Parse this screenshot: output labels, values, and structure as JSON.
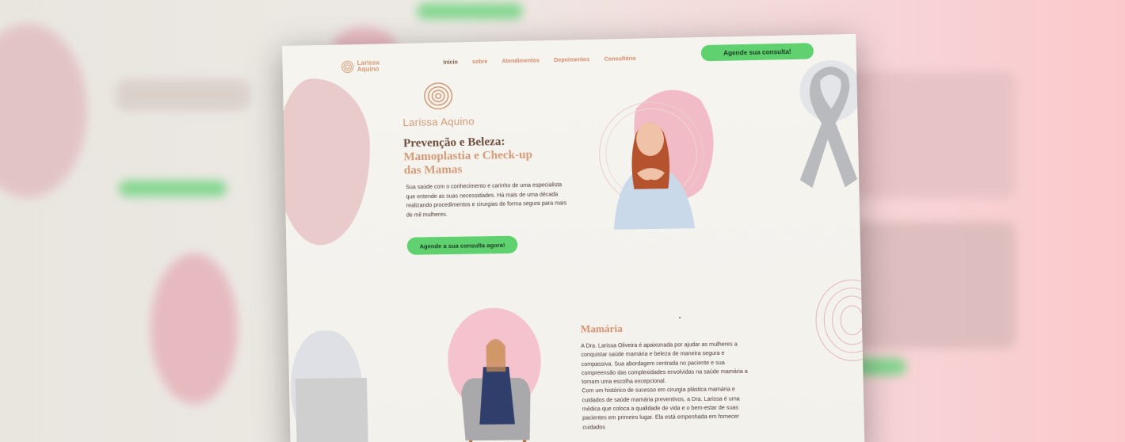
{
  "nav": {
    "logo_line1": "Larissa",
    "logo_line2": "Aquino",
    "links": [
      "Início",
      "sobre",
      "Atendimentos",
      "Depoimentos",
      "Consultório"
    ],
    "cta_label": "Agende sua consulta!"
  },
  "hero": {
    "brand_name": "Larissa Aquino",
    "title_line1": "Prevenção e Beleza:",
    "title_line2": "Mamoplastia e Check-up",
    "title_line3": "das Mamas",
    "paragraph": "Sua saúde com o conhecimento e carinho de uma especialista que entende as suas necessidades. Há mais de uma década realizando procedimentos e cirurgias de forma segura para mais de mil mulheres.",
    "button_label": "Agende a sua consulta agora!"
  },
  "section": {
    "title": "Mamária",
    "paragraph1": "A Dra. Larissa Oliveira é apaixonada por ajudar as mulheres a conquistar saúde mamária e beleza de maneira segura e compassiva. Sua abordagem centrada no paciente e sua compreensão das complexidades envolvidas na saúde mamária a tornam uma escolha excepcional.",
    "paragraph2": "Com um histórico de sucesso em cirurgia plástica mamária e cuidados de saúde mamária preventivos, a Dra. Larissa é uma médica que coloca a qualidade de vida e o bem-estar de suas pacientes em primeiro lugar. Ela está empenhada em fornecer cuidados"
  },
  "colors": {
    "accent_green": "#5fd16f",
    "brand_copper": "#d29a75",
    "title_brown": "#6e4d3e",
    "blob_pink": "#e8c3c6"
  }
}
